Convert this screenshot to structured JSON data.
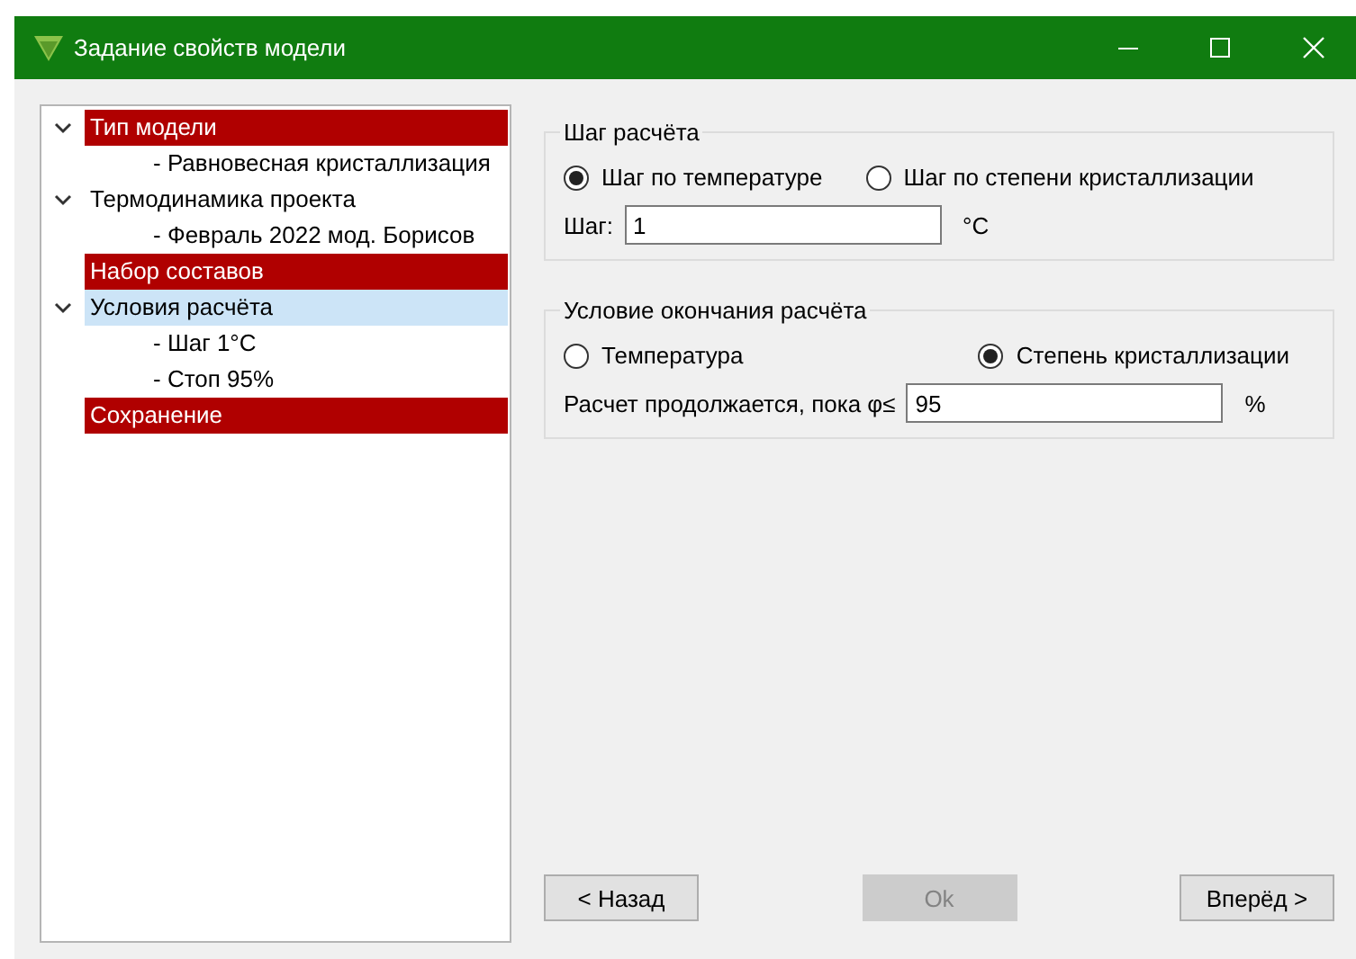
{
  "window": {
    "title": "Задание свойств модели"
  },
  "tree": [
    {
      "label": "Тип модели",
      "flagged": true,
      "selected": false,
      "expanded": true,
      "children": [
        {
          "label": "- Равновесная кристаллизация"
        }
      ]
    },
    {
      "label": "Термодинамика проекта",
      "flagged": false,
      "selected": false,
      "expanded": true,
      "children": [
        {
          "label": "- Февраль 2022 мод. Борисов"
        }
      ]
    },
    {
      "label": "Набор составов",
      "flagged": true,
      "selected": false
    },
    {
      "label": "Условия расчёта",
      "flagged": false,
      "selected": true,
      "expanded": true,
      "children": [
        {
          "label": "- Шаг 1°C"
        },
        {
          "label": "- Стоп 95%"
        }
      ]
    },
    {
      "label": "Сохранение",
      "flagged": true,
      "selected": false
    }
  ],
  "step_group": {
    "title": "Шаг расчёта",
    "options": [
      {
        "label": "Шаг по температуре",
        "selected": true
      },
      {
        "label": "Шаг по степени кристаллизации",
        "selected": false
      }
    ],
    "field_label": "Шаг:",
    "value": "1",
    "unit": "°C"
  },
  "end_group": {
    "title": "Условие окончания расчёта",
    "options": [
      {
        "label": "Температура",
        "selected": false
      },
      {
        "label": "Степень кристаллизации",
        "selected": true
      }
    ],
    "field_label": "Расчет продолжается, пока φ≤",
    "value": "95",
    "unit": "%"
  },
  "buttons": [
    {
      "label": "< Назад",
      "disabled": false
    },
    {
      "label": "Ok",
      "disabled": true
    },
    {
      "label": "Вперёд >",
      "disabled": false
    }
  ]
}
